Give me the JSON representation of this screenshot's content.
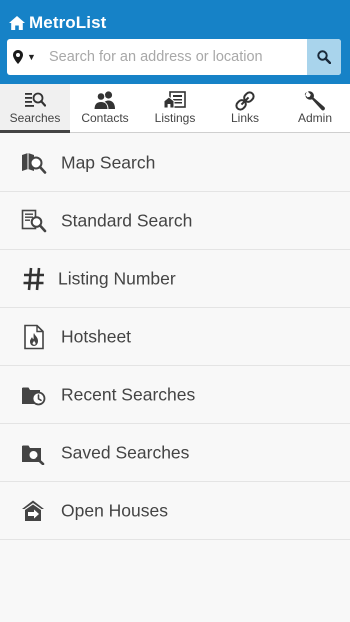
{
  "app": {
    "brand": "MetroList",
    "brand_icon": "home-icon"
  },
  "search": {
    "location_icon": "map-pin-icon",
    "placeholder": "Search for an address or location",
    "value": "",
    "button_icon": "search-icon"
  },
  "tabs": [
    {
      "label": "Searches",
      "icon": "searches-icon",
      "active": true
    },
    {
      "label": "Contacts",
      "icon": "contacts-icon",
      "active": false
    },
    {
      "label": "Listings",
      "icon": "listings-icon",
      "active": false
    },
    {
      "label": "Links",
      "icon": "links-icon",
      "active": false
    },
    {
      "label": "Admin",
      "icon": "wrench-icon",
      "active": false
    }
  ],
  "menu": [
    {
      "label": "Map Search",
      "icon": "map-search-icon"
    },
    {
      "label": "Standard Search",
      "icon": "standard-search-icon"
    },
    {
      "label": "Listing Number",
      "icon": "hash-icon"
    },
    {
      "label": "Hotsheet",
      "icon": "hotsheet-icon"
    },
    {
      "label": "Recent Searches",
      "icon": "recent-searches-icon"
    },
    {
      "label": "Saved Searches",
      "icon": "saved-searches-icon"
    },
    {
      "label": "Open Houses",
      "icon": "open-houses-icon"
    }
  ],
  "colors": {
    "header": "#1682c7",
    "search_button": "#a9d4ec",
    "text": "#444444"
  }
}
